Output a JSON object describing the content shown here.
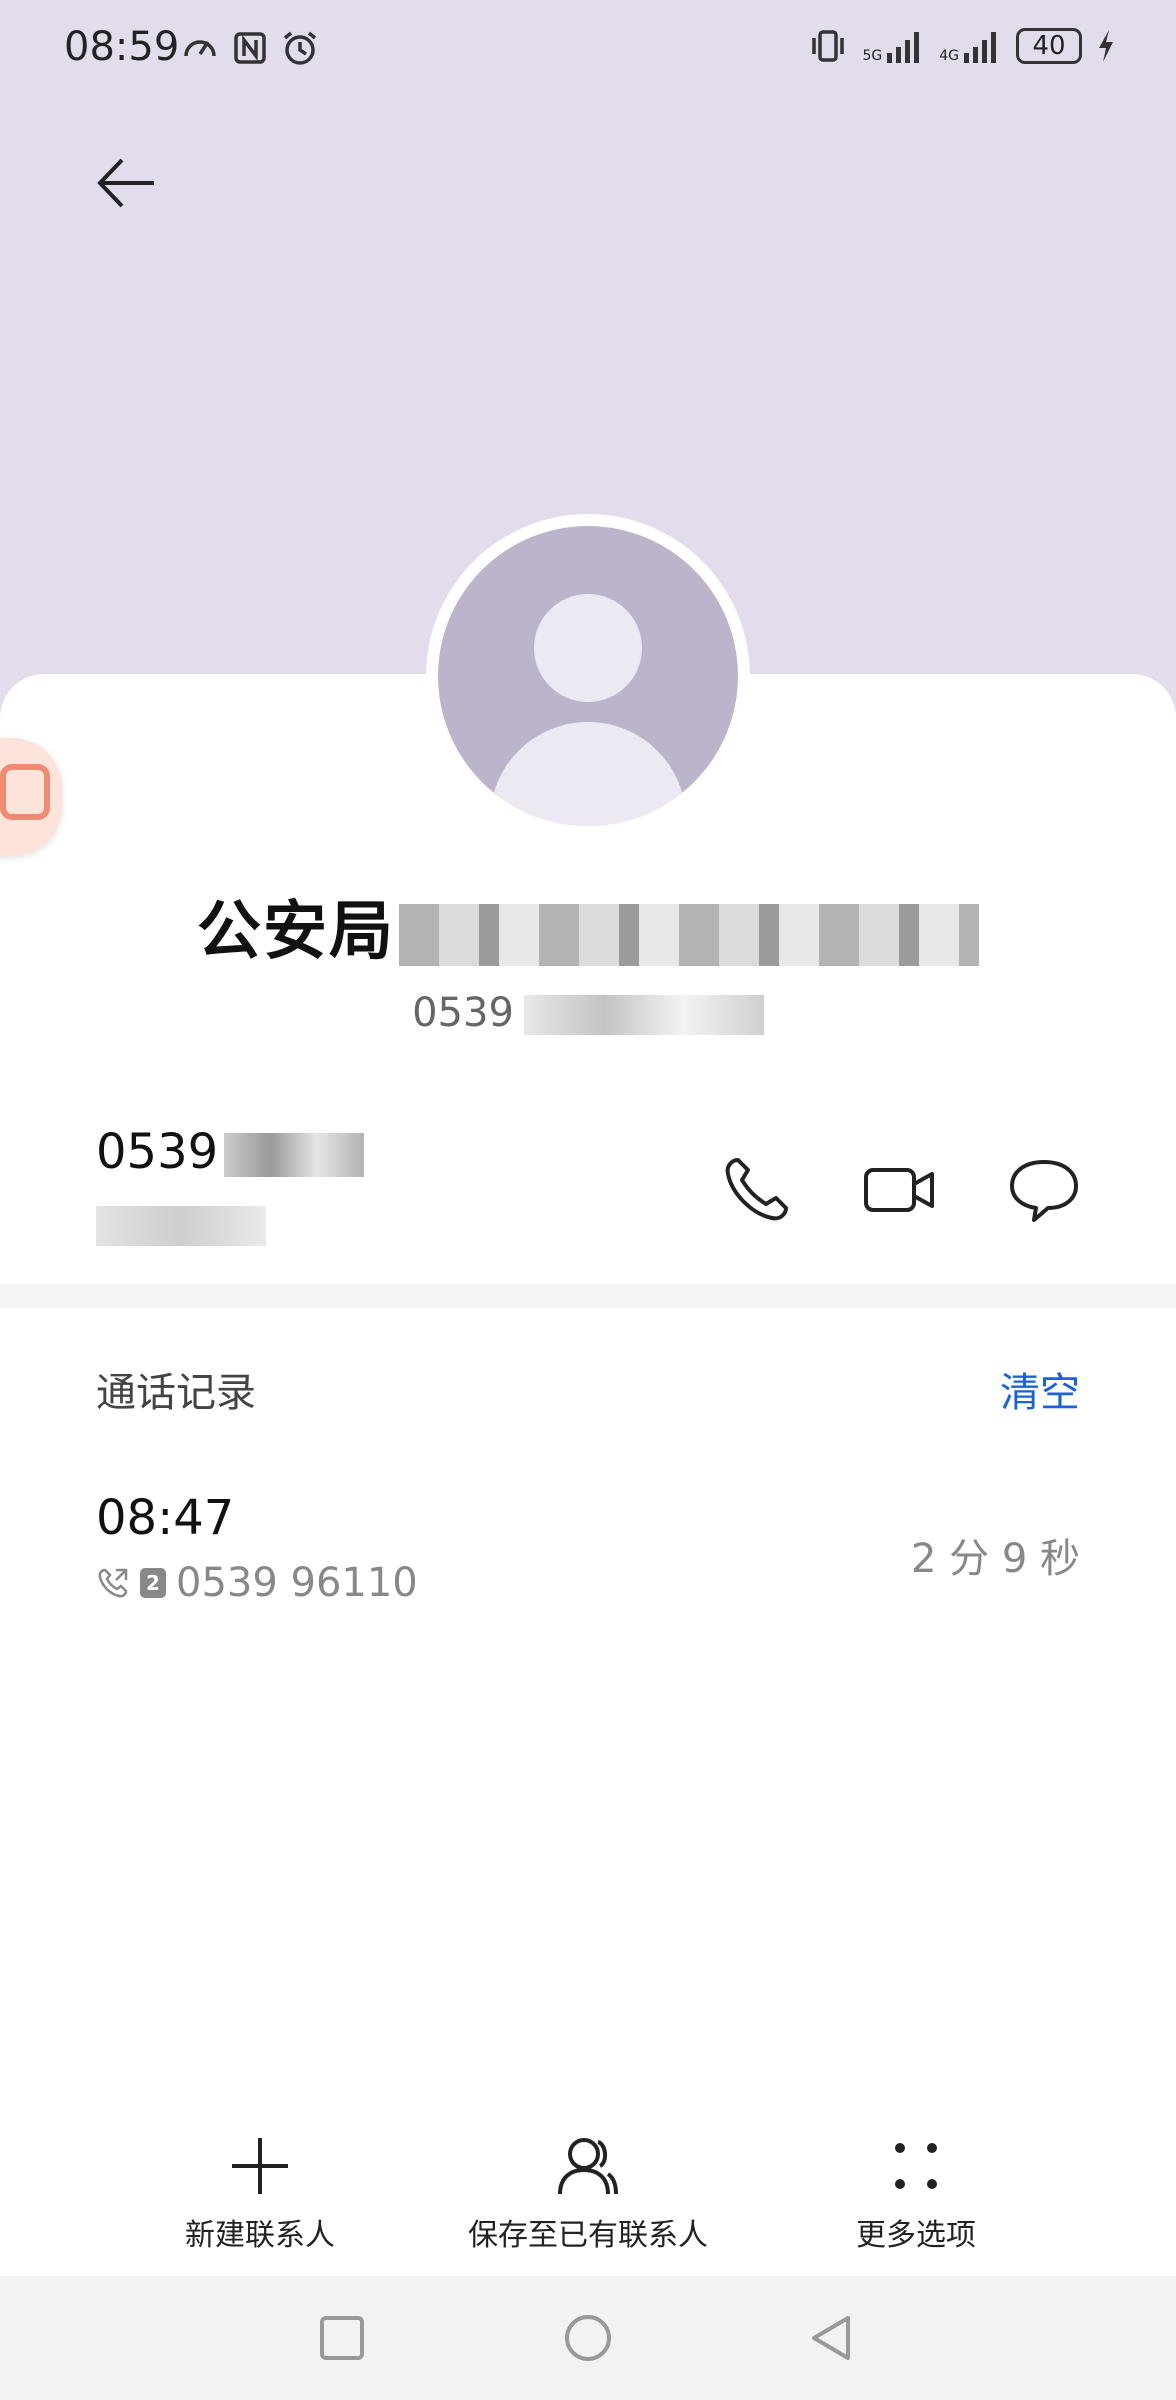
{
  "status_bar": {
    "time": "08:59",
    "battery": "40",
    "network_5g": "5G",
    "network_4g": "4G",
    "left_icons": [
      "speedometer-icon",
      "nfc-icon",
      "alarm-icon"
    ],
    "right_icons": [
      "vibrate-icon",
      "signal-5g-icon",
      "signal-4g-icon",
      "battery-icon",
      "charging-icon"
    ]
  },
  "contact": {
    "name": "公安局",
    "subtitle": "0539",
    "avatar": "person-avatar-icon"
  },
  "number": {
    "value": "0539",
    "location": ""
  },
  "actions": {
    "call": "phone-icon",
    "video": "video-call-icon",
    "message": "message-icon"
  },
  "call_log": {
    "title": "通话记录",
    "clear_label": "清空",
    "entries": [
      {
        "time": "08:47",
        "number": "0539 96110",
        "sim": "2",
        "duration": "2 分 9 秒"
      }
    ]
  },
  "bottom_bar": {
    "new_contact": "新建联系人",
    "save_existing": "保存至已有联系人",
    "more_options": "更多选项"
  },
  "colors": {
    "header_bg": "#e2dcec",
    "accent": "#1b62d4",
    "avatar_bg": "#bcb4cb"
  }
}
